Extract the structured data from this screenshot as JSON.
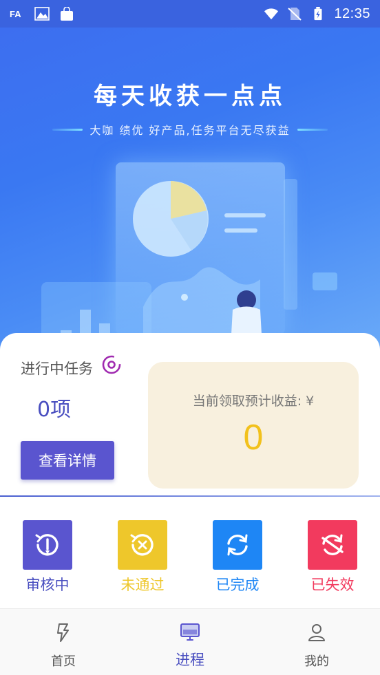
{
  "status_bar": {
    "time": "12:35",
    "left_icons": [
      "font-icon",
      "gallery-icon",
      "shopping-bag-icon"
    ],
    "right_icons": [
      "wifi-icon",
      "no-sim-icon",
      "battery-charging-icon"
    ]
  },
  "hero": {
    "title": "每天收获一点点",
    "subtitle": "大咖 绩优 好产品,任务平台无尽获益"
  },
  "task_panel": {
    "label": "进行中任务",
    "count": "0项",
    "detail_button": "查看详情",
    "earnings_label": "当前领取预计收益: ¥",
    "earnings_value": "0"
  },
  "status_grid": [
    {
      "label": "审核中",
      "color": "#5a55cf",
      "icon": "clock-history-icon"
    },
    {
      "label": "未通过",
      "color": "#eec72b",
      "icon": "clock-x-icon"
    },
    {
      "label": "已完成",
      "color": "#1e86f5",
      "icon": "refresh-icon"
    },
    {
      "label": "已失效",
      "color": "#f23a5e",
      "icon": "expired-icon"
    }
  ],
  "bottom_nav": {
    "active": "进程",
    "items": [
      {
        "label": "首页",
        "icon": "lightning-icon"
      },
      {
        "label": "进程",
        "icon": "monitor-icon"
      },
      {
        "label": "我的",
        "icon": "user-icon"
      }
    ]
  }
}
